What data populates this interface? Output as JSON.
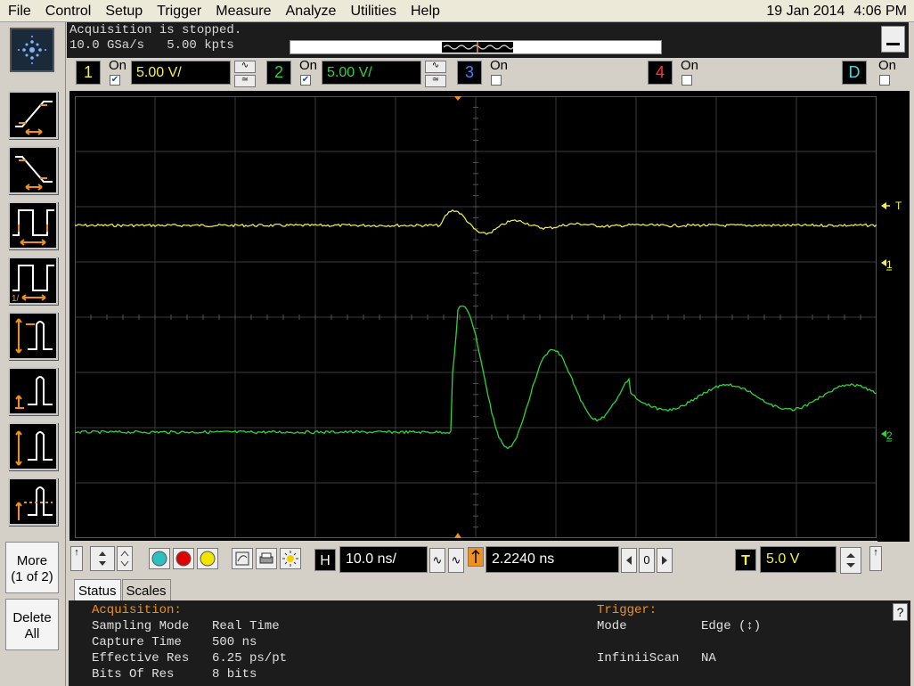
{
  "menu": {
    "items": [
      "File",
      "Control",
      "Setup",
      "Trigger",
      "Measure",
      "Analyze",
      "Utilities",
      "Help"
    ]
  },
  "datetime": {
    "date": "19 Jan 2014",
    "time": "4:06 PM"
  },
  "acquisition_strip": {
    "status": "Acquisition is stopped.",
    "rate": "10.0 GSa/s   5.00 kpts"
  },
  "channels": [
    {
      "number": "1",
      "on_label": "On",
      "checked": true,
      "scale": "5.00 V/",
      "color": "#f5f24a"
    },
    {
      "number": "2",
      "on_label": "On",
      "checked": true,
      "scale": "5.00 V/",
      "color": "#2fd33a"
    },
    {
      "number": "3",
      "on_label": "On",
      "checked": false,
      "color": "#4a7fff"
    },
    {
      "number": "4",
      "on_label": "On",
      "checked": false,
      "color": "#ff3a3a"
    },
    {
      "number": "D",
      "on_label": "On",
      "checked": false,
      "color": "#44d8e0"
    }
  ],
  "markers": {
    "trigger_level": "T",
    "ch1": "1",
    "ch2": "2"
  },
  "horizontal": {
    "badge": "H",
    "scale": "10.0 ns/",
    "delay": "2.2240 ns",
    "ref_value": "0"
  },
  "trigger_ctrl": {
    "badge": "T",
    "level": "5.0 V"
  },
  "side_buttons": {
    "more_line1": "More",
    "more_line2": "(1 of 2)",
    "delete_line1": "Delete",
    "delete_line2": "All"
  },
  "tabs": [
    "Status",
    "Scales"
  ],
  "status": {
    "acq_header": "Acquisition:",
    "acq_rows": [
      {
        "label": "Sampling Mode",
        "value": "Real Time"
      },
      {
        "label": "Capture Time",
        "value": "500 ns"
      },
      {
        "label": "Effective Res",
        "value": "6.25 ps/pt"
      },
      {
        "label": "Bits Of Res",
        "value": "8 bits"
      }
    ],
    "trig_header": "Trigger:",
    "trig_rows": [
      {
        "label": "Mode",
        "value": "Edge (↕)"
      },
      {
        "label": "InfiniiScan",
        "value": "NA"
      }
    ]
  },
  "help_label": "?",
  "colors": {
    "ch1": "#f5f24a",
    "ch2": "#2fd33a",
    "accent": "#f0901e"
  }
}
